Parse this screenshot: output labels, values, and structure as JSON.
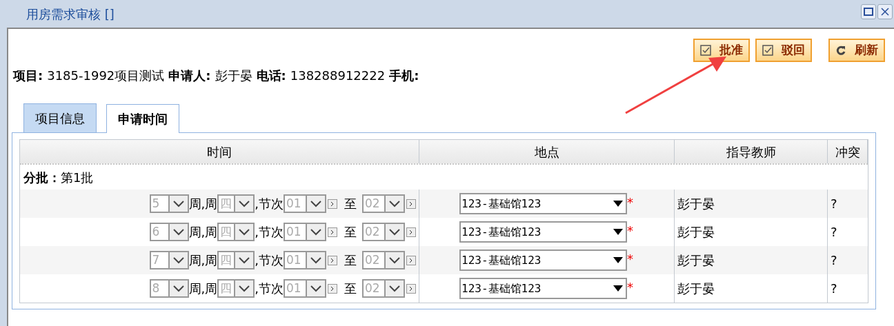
{
  "window": {
    "title": "用房需求审核 []"
  },
  "buttons": [
    {
      "label": "批准",
      "kind": "check"
    },
    {
      "label": "驳回",
      "kind": "check"
    },
    {
      "label": "刷新",
      "kind": "refresh"
    }
  ],
  "info": [
    {
      "label": "项目:",
      "value": "3185-1992项目测试"
    },
    {
      "label": "申请人:",
      "value": "彭于晏"
    },
    {
      "label": "电话:",
      "value": "138288912222"
    },
    {
      "label": "手机:"
    }
  ],
  "tabs": [
    {
      "label": "项目信息",
      "selected": false
    },
    {
      "label": "申请时间",
      "selected": true
    }
  ],
  "table": {
    "columns": [
      "时间",
      "地点",
      "指导教师",
      "冲突"
    ],
    "group": {
      "label": "分批：",
      "value": "第1批"
    },
    "rows": [
      {
        "week": "5",
        "week_label": "周,周",
        "weekday": "四",
        "period_label": ",节次",
        "start": "01",
        "to_label": "至",
        "end": "02",
        "location": "123-基础馆123",
        "required_mark": "*",
        "teacher": "彭于晏",
        "conflict": "?"
      },
      {
        "week": "6",
        "week_label": "周,周",
        "weekday": "四",
        "period_label": ",节次",
        "start": "01",
        "to_label": "至",
        "end": "02",
        "location": "123-基础馆123",
        "required_mark": "*",
        "teacher": "彭于晏",
        "conflict": "?"
      },
      {
        "week": "7",
        "week_label": "周,周",
        "weekday": "四",
        "period_label": ",节次",
        "start": "01",
        "to_label": "至",
        "end": "02",
        "location": "123-基础馆123",
        "required_mark": "*",
        "teacher": "彭于晏",
        "conflict": "?"
      },
      {
        "week": "8",
        "week_label": "周,周",
        "weekday": "四",
        "period_label": ",节次",
        "start": "01",
        "to_label": "至",
        "end": "02",
        "location": "123-基础馆123",
        "required_mark": "*",
        "teacher": "彭于晏",
        "conflict": "?"
      }
    ]
  }
}
